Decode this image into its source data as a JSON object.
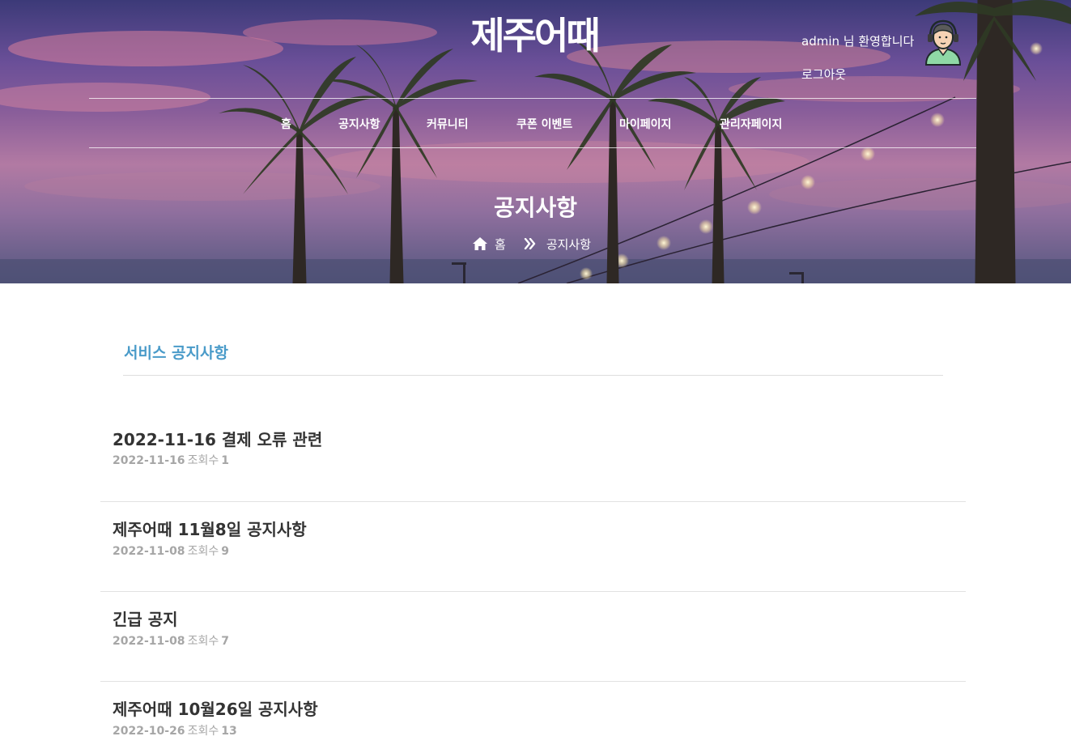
{
  "header": {
    "logo": "제주어때",
    "welcome_text": "admin 님 환영합니다",
    "logout_label": "로그아웃",
    "avatar_icon": "user-avatar-icon"
  },
  "nav": {
    "items": [
      {
        "label": "홈"
      },
      {
        "label": "공지사항"
      },
      {
        "label": "커뮤니티"
      },
      {
        "label": "쿠폰 이벤트"
      },
      {
        "label": "마이페이지"
      },
      {
        "label": "관리자페이지"
      }
    ]
  },
  "hero": {
    "title": "공지사항",
    "breadcrumb": {
      "home_icon": "home-icon",
      "home": "홈",
      "separator_icon": "double-chevron-right-icon",
      "current": "공지사항"
    }
  },
  "section": {
    "title": "서비스 공지사항",
    "title_color": "#4a9bc9"
  },
  "notices": [
    {
      "title": "2022-11-16 결제 오류 관련",
      "date": "2022-11-16",
      "views_label": "조회수",
      "views": "1"
    },
    {
      "title": "제주어때 11월8일 공지사항",
      "date": "2022-11-08",
      "views_label": "조회수",
      "views": "9"
    },
    {
      "title": "긴급 공지",
      "date": "2022-11-08",
      "views_label": "조회수",
      "views": "7"
    },
    {
      "title": "제주어때 10월26일 공지사항",
      "date": "2022-10-26",
      "views_label": "조회수",
      "views": "13"
    }
  ]
}
